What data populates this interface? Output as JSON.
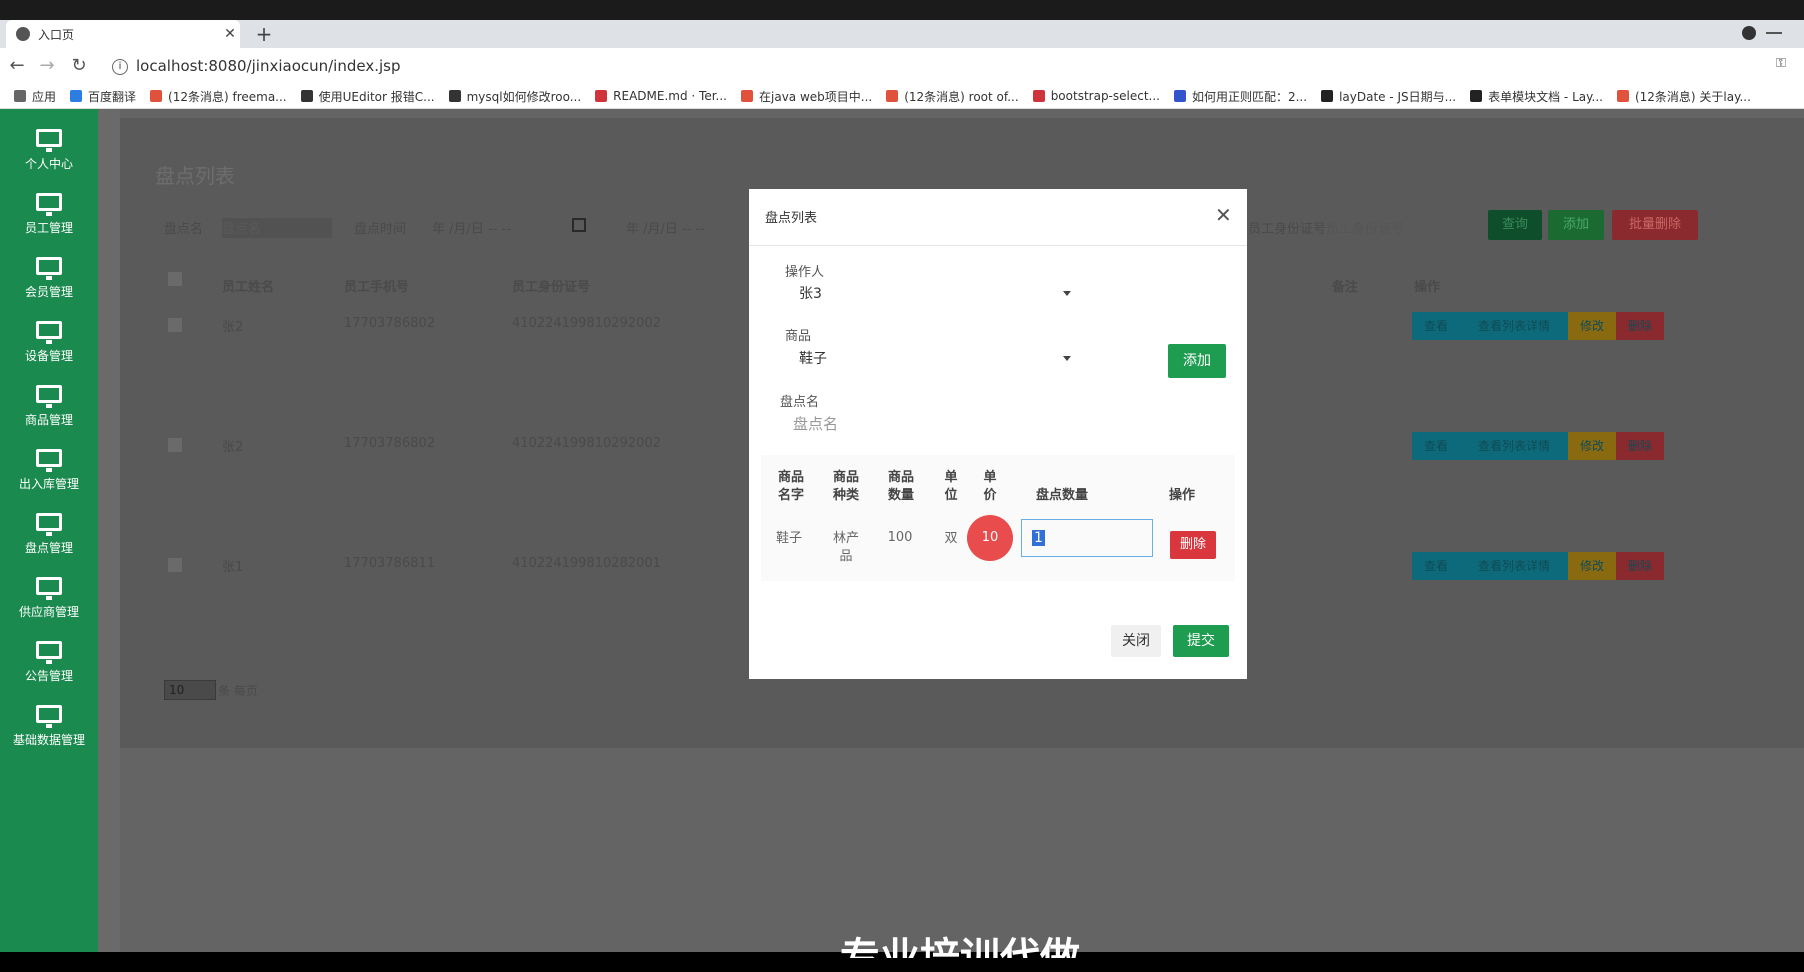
{
  "browser": {
    "tab_title": "入口页",
    "url": "localhost:8080/jinxiaocun/index.jsp",
    "bookmarks": [
      {
        "label": "应用",
        "color": "#666"
      },
      {
        "label": "百度翻译",
        "color": "#2b7de1"
      },
      {
        "label": "(12条消息) freema...",
        "color": "#e1523d"
      },
      {
        "label": "使用UEditor 报错C...",
        "color": "#333"
      },
      {
        "label": "mysql如何修改roo...",
        "color": "#333"
      },
      {
        "label": "README.md · Ter...",
        "color": "#d0343a"
      },
      {
        "label": "在java web项目中...",
        "color": "#e1523d"
      },
      {
        "label": "(12条消息) root of...",
        "color": "#e1523d"
      },
      {
        "label": "bootstrap-select...",
        "color": "#d0343a"
      },
      {
        "label": "如何用正则匹配：2...",
        "color": "#3355cc"
      },
      {
        "label": "layDate - JS日期与...",
        "color": "#222"
      },
      {
        "label": "表单模块文档 - Lay...",
        "color": "#222"
      },
      {
        "label": "(12条消息) 关于lay...",
        "color": "#e1523d"
      }
    ]
  },
  "sidebar": {
    "items": [
      {
        "label": "个人中心"
      },
      {
        "label": "员工管理"
      },
      {
        "label": "会员管理"
      },
      {
        "label": "设备管理"
      },
      {
        "label": "商品管理"
      },
      {
        "label": "出入库管理"
      },
      {
        "label": "盘点管理"
      },
      {
        "label": "供应商管理"
      },
      {
        "label": "公告管理"
      },
      {
        "label": "基础数据管理"
      }
    ]
  },
  "background_page": {
    "title": "盘点列表",
    "filters": {
      "name_label": "盘点名",
      "name_placeholder": "盘点名",
      "time_label": "盘点时间",
      "date_from": "年 /月/日 -- --",
      "date_to": "年 /月/日 -- --",
      "id_label": "员工身份证号",
      "id_placeholder": "员工身份证号"
    },
    "buttons": {
      "search": "查询",
      "add": "添加",
      "batch_delete": "批量删除"
    },
    "columns": [
      "员工姓名",
      "员工手机号",
      "员工身份证号",
      "备注",
      "操作"
    ],
    "rows": [
      {
        "name": "张2",
        "phone": "17703786802",
        "id": "410224199810292002"
      },
      {
        "name": "张2",
        "phone": "17703786802",
        "id": "410224199810292002"
      },
      {
        "name": "张1",
        "phone": "17703786811",
        "id": "410224199810282001"
      }
    ],
    "row_actions": [
      "查看",
      "查看列表详情",
      "修改",
      "删除"
    ],
    "page_size": "10",
    "page_size_suffix": "条 每页"
  },
  "modal": {
    "title": "盘点列表",
    "operator_label": "操作人",
    "operator_value": "张3",
    "goods_label": "商品",
    "goods_value": "鞋子",
    "add_button": "添加",
    "check_name_label": "盘点名",
    "check_name_placeholder": "盘点名",
    "table": {
      "headers": [
        "商品名字",
        "商品种类",
        "商品数量",
        "单位",
        "单价",
        "盘点数量",
        "操作"
      ],
      "row": {
        "name": "鞋子",
        "category": "林产品",
        "quantity": "100",
        "unit": "双",
        "price": "10",
        "count": "1"
      },
      "delete_button": "删除"
    },
    "close_button": "关闭",
    "submit_button": "提交"
  },
  "subtitle": "专业培训代做"
}
